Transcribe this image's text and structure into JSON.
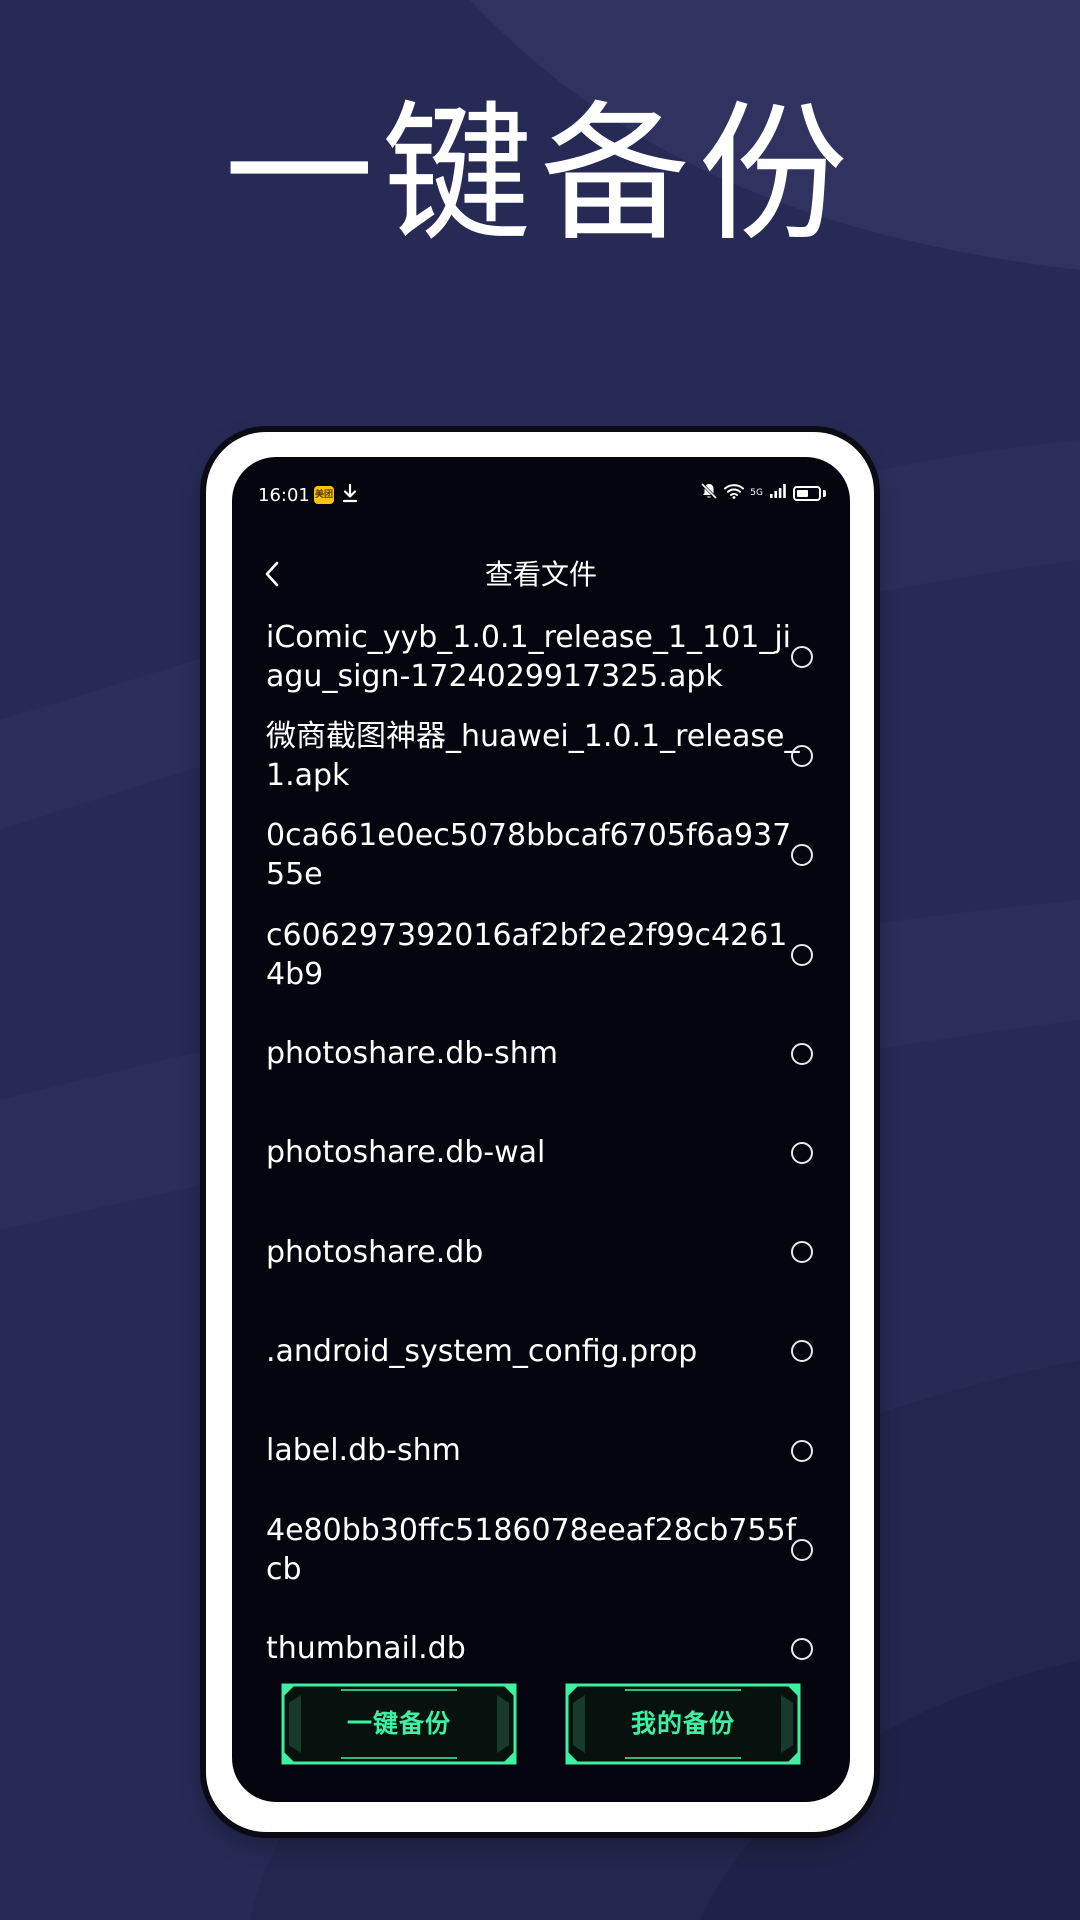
{
  "headline": "一键备份",
  "colors": {
    "background": "#262a55",
    "accent": "#3ef0a2",
    "screen": "#05050f"
  },
  "status_bar": {
    "time": "16:01",
    "badge": "美团",
    "network": "5G",
    "icons": [
      "download-icon",
      "mute-bell-icon",
      "wifi-icon",
      "signal-icon",
      "battery-icon"
    ],
    "battery_level": 0.55
  },
  "nav": {
    "title": "查看文件",
    "back_icon": "chevron-left-icon"
  },
  "files": [
    {
      "name": "iComic_yyb_1.0.1_release_1_101_jiagu_sign-1724029917325.apk"
    },
    {
      "name": "微商截图神器_huawei_1.0.1_release_1.apk"
    },
    {
      "name": "0ca661e0ec5078bbcaf6705f6a93755e"
    },
    {
      "name": "c606297392016af2bf2e2f99c42614b9"
    },
    {
      "name": "photoshare.db-shm"
    },
    {
      "name": "photoshare.db-wal"
    },
    {
      "name": "photoshare.db"
    },
    {
      "name": ".android_system_config.prop"
    },
    {
      "name": "label.db-shm"
    },
    {
      "name": "4e80bb30ffc5186078eeaf28cb755fcb"
    },
    {
      "name": "thumbnail.db"
    }
  ],
  "buttons": {
    "backup_label": "一键备份",
    "my_backup_label": "我的备份"
  }
}
